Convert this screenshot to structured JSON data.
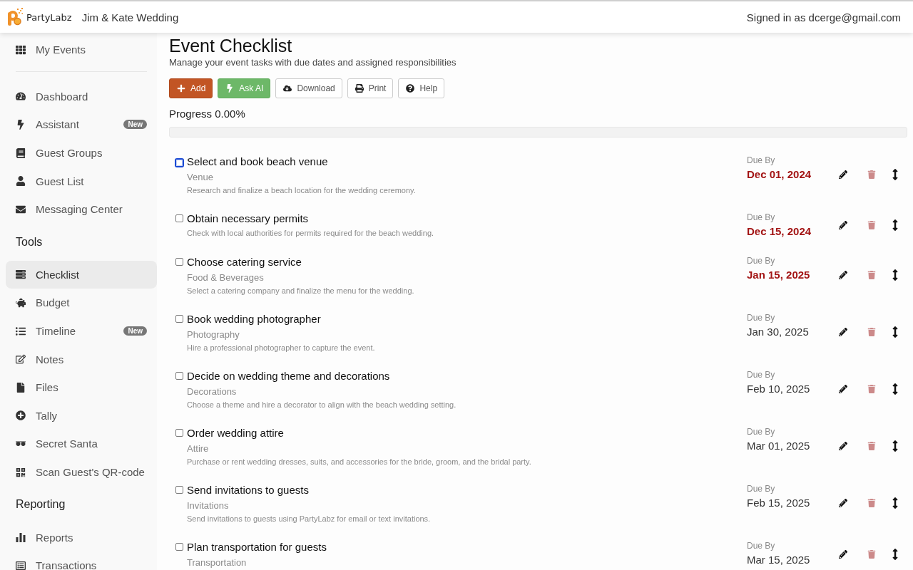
{
  "header": {
    "brand": "PartyLabz",
    "event_name": "Jim & Kate Wedding",
    "signed_in": "Signed in as dcerge@gmail.com"
  },
  "sidebar": {
    "sections": [
      {
        "items": [
          {
            "label": "My Events",
            "selected": false
          }
        ]
      },
      {
        "items": [
          {
            "label": "Dashboard",
            "selected": false
          },
          {
            "label": "Assistant",
            "selected": false,
            "badge": "New"
          },
          {
            "label": "Guest Groups",
            "selected": false
          },
          {
            "label": "Guest List",
            "selected": false
          },
          {
            "label": "Messaging Center",
            "selected": false
          }
        ]
      },
      {
        "heading": "Tools",
        "items": [
          {
            "label": "Checklist",
            "selected": true
          },
          {
            "label": "Budget",
            "selected": false
          },
          {
            "label": "Timeline",
            "selected": false,
            "badge": "New"
          },
          {
            "label": "Notes",
            "selected": false
          },
          {
            "label": "Files",
            "selected": false
          },
          {
            "label": "Tally",
            "selected": false
          },
          {
            "label": "Secret Santa",
            "selected": false
          },
          {
            "label": "Scan Guest's QR-code",
            "selected": false
          }
        ]
      },
      {
        "heading": "Reporting",
        "items": [
          {
            "label": "Reports",
            "selected": false
          },
          {
            "label": "Transactions",
            "selected": false
          }
        ]
      }
    ]
  },
  "page": {
    "title": "Event Checklist",
    "subtitle": "Manage your event tasks with due dates and assigned responsibilities",
    "toolbar": [
      {
        "label": "Add",
        "kind": "primary"
      },
      {
        "label": "Ask AI",
        "kind": "success"
      },
      {
        "label": "Download",
        "kind": "default"
      },
      {
        "label": "Print",
        "kind": "default"
      },
      {
        "label": "Help",
        "kind": "default"
      }
    ],
    "progress": {
      "label": "Progress 0.00%"
    }
  },
  "tasks": [
    {
      "title": "Select and book beach venue",
      "category": "Venue",
      "description": "Research and finalize a beach location for the wedding ceremony.",
      "due_label": "Due By",
      "due_date": "Dec 01, 2024",
      "overdue": true,
      "checked": false,
      "focused": true
    },
    {
      "title": "Obtain necessary permits",
      "description": "Check with local authorities for permits required for the beach wedding.",
      "due_label": "Due By",
      "due_date": "Dec 15, 2024",
      "overdue": true,
      "checked": false,
      "focused": false
    },
    {
      "title": "Choose catering service",
      "category": "Food & Beverages",
      "description": "Select a catering company and finalize the menu for the wedding.",
      "due_label": "Due By",
      "due_date": "Jan 15, 2025",
      "overdue": true,
      "checked": false,
      "focused": false
    },
    {
      "title": "Book wedding photographer",
      "category": "Photography",
      "description": "Hire a professional photographer to capture the event.",
      "due_label": "Due By",
      "due_date": "Jan 30, 2025",
      "overdue": false,
      "checked": false,
      "focused": false
    },
    {
      "title": "Decide on wedding theme and decorations",
      "category": "Decorations",
      "description": "Choose a theme and hire a decorator to align with the beach wedding setting.",
      "due_label": "Due By",
      "due_date": "Feb 10, 2025",
      "overdue": false,
      "checked": false,
      "focused": false
    },
    {
      "title": "Order wedding attire",
      "category": "Attire",
      "description": "Purchase or rent wedding dresses, suits, and accessories for the bride, groom, and the bridal party.",
      "due_label": "Due By",
      "due_date": "Mar 01, 2025",
      "overdue": false,
      "checked": false,
      "focused": false
    },
    {
      "title": "Send invitations to guests",
      "category": "Invitations",
      "description": "Send invitations to guests using PartyLabz for email or text invitations.",
      "due_label": "Due By",
      "due_date": "Feb 15, 2025",
      "overdue": false,
      "checked": false,
      "focused": false
    },
    {
      "title": "Plan transportation for guests",
      "category": "Transportation",
      "due_label": "Due By",
      "due_date": "Mar 15, 2025",
      "overdue": false,
      "checked": false,
      "focused": false
    }
  ]
}
